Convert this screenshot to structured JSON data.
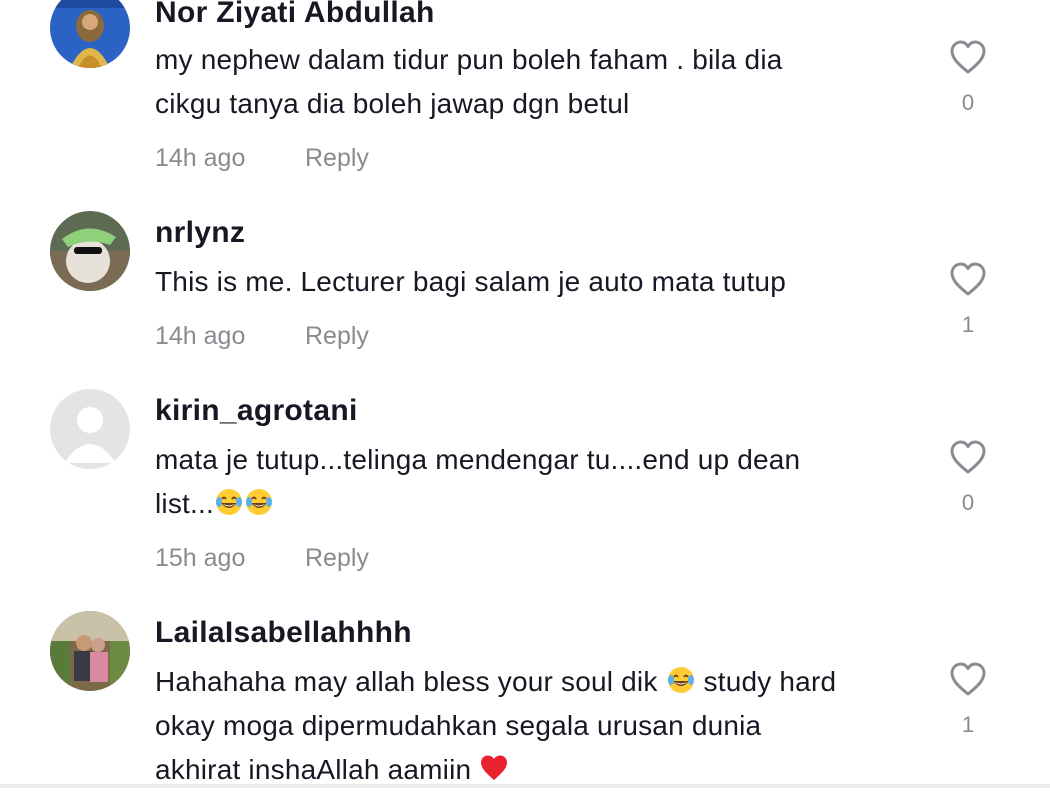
{
  "colors": {
    "text": "#161823",
    "muted": "#8a8b91",
    "heart": "#e8232f"
  },
  "comments": [
    {
      "username": "Nor Ziyati Abdullah",
      "text_lines": [
        "my nephew dalam tidur pun boleh faham . bila dia",
        "cikgu tanya dia boleh jawap dgn betul"
      ],
      "time": "14h ago",
      "reply": "Reply",
      "likes": "0"
    },
    {
      "username": "nrlynz",
      "text_lines": [
        "This is me. Lecturer bagi salam je auto mata tutup"
      ],
      "time": "14h ago",
      "reply": "Reply",
      "likes": "1"
    },
    {
      "username": "kirin_agrotani",
      "text_lines": [
        "mata je tutup...telinga mendengar tu....end up dean",
        "list..."
      ],
      "emoji_line2": [
        "face-with-tears-of-joy",
        "face-with-tears-of-joy"
      ],
      "time": "15h ago",
      "reply": "Reply",
      "likes": "0"
    },
    {
      "username": "LailaIsabellahhhh",
      "text_line1_a": "Hahahaha may allah bless your soul dik ",
      "text_line1_b": " study hard",
      "text_lines": [
        "okay moga dipermudahkan segala urusan dunia",
        "akhirat inshaAllah aamiin "
      ],
      "emoji_line1": "face-with-tears-of-joy",
      "emoji_line3": "red-heart",
      "likes": "1"
    }
  ]
}
